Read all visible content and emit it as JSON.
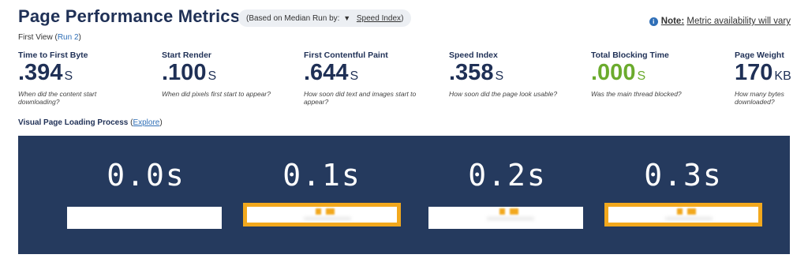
{
  "header": {
    "title": "Page Performance Metrics",
    "run_pill_prefix": "(Based on Median Run by:",
    "run_pill_caret": "▼",
    "run_pill_selected": "Speed Index",
    "run_pill_suffix": ")",
    "note_label": "Note:",
    "note_text": "Metric availability will vary"
  },
  "first_view": {
    "label": "First View",
    "run_link": "Run 2"
  },
  "metrics": [
    {
      "label": "Time to First Byte",
      "value": ".394",
      "unit": "S",
      "desc": "When did the content start downloading?",
      "color": "#1f3056"
    },
    {
      "label": "Start Render",
      "value": ".100",
      "unit": "S",
      "desc": "When did pixels first start to appear?",
      "color": "#1f3056"
    },
    {
      "label": "First Contentful Paint",
      "value": ".644",
      "unit": "S",
      "desc": "How soon did text and images start to appear?",
      "color": "#1f3056"
    },
    {
      "label": "Speed Index",
      "value": ".358",
      "unit": "S",
      "desc": "How soon did the page look usable?",
      "color": "#1f3056"
    },
    {
      "label": "Total Blocking Time",
      "value": ".000",
      "unit": "S",
      "desc": "Was the main thread blocked?",
      "color": "#6bab2d"
    },
    {
      "label": "Page Weight",
      "value": "170",
      "unit": "KB",
      "desc": "How many bytes downloaded?",
      "color": "#1f3056"
    }
  ],
  "visual_loading": {
    "label": "Visual Page Loading Process",
    "explore_link": "Explore"
  },
  "filmstrip": {
    "background": "#253a5e",
    "highlight_color": "#f2a81d",
    "frames": [
      {
        "time": "0.0s",
        "changed": false
      },
      {
        "time": "0.1s",
        "changed": true
      },
      {
        "time": "0.2s",
        "changed": false
      },
      {
        "time": "0.3s",
        "changed": true
      }
    ]
  },
  "icons": {
    "info": "info-icon",
    "caret": "caret-down-icon"
  }
}
